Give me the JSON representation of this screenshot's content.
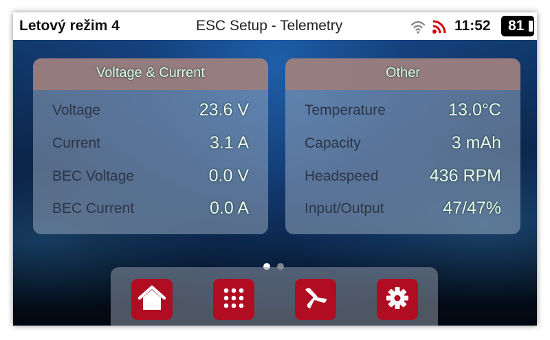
{
  "status_bar": {
    "mode_title": "Letový režim 4",
    "screen_title": "ESC Setup - Telemetry",
    "time": "11:52",
    "battery": "81",
    "icons": [
      "wifi-icon",
      "telemetry-signal-icon"
    ],
    "telemetry_icon_color": "#d40000"
  },
  "panels": [
    {
      "title": "Voltage & Current",
      "rows": [
        {
          "label": "Voltage",
          "value": "23.6 V"
        },
        {
          "label": "Current",
          "value": "3.1 A"
        },
        {
          "label": "BEC Voltage",
          "value": "0.0 V"
        },
        {
          "label": "BEC Current",
          "value": "0.0 A"
        }
      ]
    },
    {
      "title": "Other",
      "rows": [
        {
          "label": "Temperature",
          "value": "13.0°C"
        },
        {
          "label": "Capacity",
          "value": "3 mAh"
        },
        {
          "label": "Headspeed",
          "value": "436 RPM"
        },
        {
          "label": "Input/Output",
          "value": "47/47%"
        }
      ]
    }
  ],
  "pager": {
    "pages": 2,
    "active": 1
  },
  "dock": {
    "accent_color": "#b00d22",
    "buttons": [
      "home-icon",
      "apps-grid-icon",
      "rotor-icon",
      "gear-icon"
    ]
  }
}
